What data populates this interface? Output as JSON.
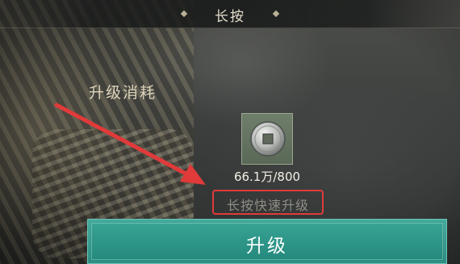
{
  "title": "长按",
  "cost_section": {
    "label": "升级消耗"
  },
  "item": {
    "icon": "copper-coin-icon",
    "amount": "66.1万/800"
  },
  "hint": {
    "text": "长按快速升级"
  },
  "upgrade_button": {
    "label": "升级"
  },
  "colors": {
    "button": "#2a9184",
    "highlight_box": "#e03a3a",
    "arrow": "#e03a3a"
  }
}
